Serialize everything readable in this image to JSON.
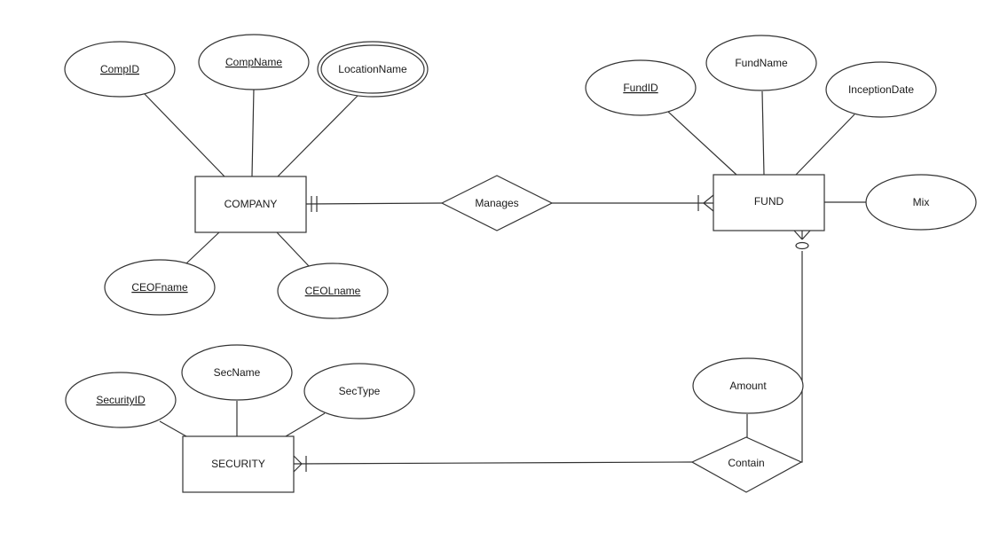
{
  "diagram": {
    "type": "er-diagram",
    "entities": [
      {
        "id": "company",
        "label": "COMPANY"
      },
      {
        "id": "fund",
        "label": "FUND"
      },
      {
        "id": "security",
        "label": "SECURITY"
      }
    ],
    "relationships": [
      {
        "id": "manages",
        "label": "Manages"
      },
      {
        "id": "contain",
        "label": "Contain"
      }
    ],
    "attributes": [
      {
        "id": "compid",
        "label": "CompID",
        "key": true,
        "multivalued": false,
        "owner": "company"
      },
      {
        "id": "compname",
        "label": "CompName",
        "key": true,
        "multivalued": false,
        "owner": "company"
      },
      {
        "id": "locationname",
        "label": "LocationName",
        "key": false,
        "multivalued": true,
        "owner": "company"
      },
      {
        "id": "ceofname",
        "label": "CEOFname",
        "key": true,
        "multivalued": false,
        "owner": "company"
      },
      {
        "id": "ceolname",
        "label": "CEOLname",
        "key": true,
        "multivalued": false,
        "owner": "company"
      },
      {
        "id": "fundid",
        "label": "FundID",
        "key": true,
        "multivalued": false,
        "owner": "fund"
      },
      {
        "id": "fundname",
        "label": "FundName",
        "key": false,
        "multivalued": false,
        "owner": "fund"
      },
      {
        "id": "inceptiondate",
        "label": "InceptionDate",
        "key": false,
        "multivalued": false,
        "owner": "fund"
      },
      {
        "id": "mix",
        "label": "Mix",
        "key": false,
        "multivalued": false,
        "owner": "fund"
      },
      {
        "id": "securityid",
        "label": "SecurityID",
        "key": true,
        "multivalued": false,
        "owner": "security"
      },
      {
        "id": "secname",
        "label": "SecName",
        "key": false,
        "multivalued": false,
        "owner": "security"
      },
      {
        "id": "sectype",
        "label": "SecType",
        "key": false,
        "multivalued": false,
        "owner": "security"
      },
      {
        "id": "amount",
        "label": "Amount",
        "key": false,
        "multivalued": false,
        "owner": "contain"
      }
    ],
    "connections": [
      {
        "from": "company",
        "to": "manages",
        "from_cardinality": "one-and-only-one",
        "to_cardinality": "none"
      },
      {
        "from": "manages",
        "to": "fund",
        "from_cardinality": "none",
        "to_cardinality": "one-or-many"
      },
      {
        "from": "fund",
        "to": "contain",
        "from_cardinality": "zero-or-many",
        "to_cardinality": "none"
      },
      {
        "from": "contain",
        "to": "security",
        "from_cardinality": "none",
        "to_cardinality": "one-or-many"
      }
    ],
    "colors": {
      "stroke": "#333333",
      "fill": "#ffffff",
      "text": "#1a1a1a"
    }
  }
}
